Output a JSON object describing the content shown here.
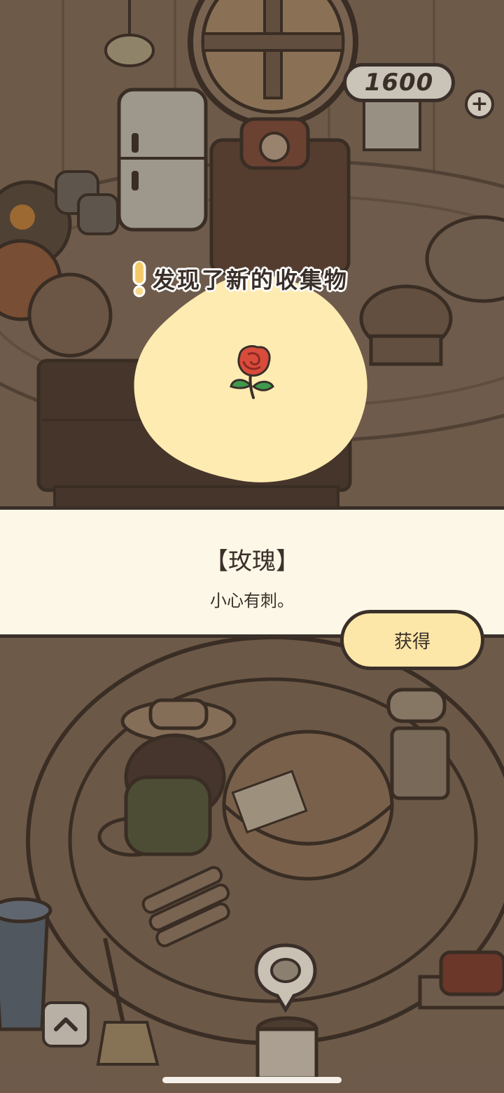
{
  "hud": {
    "coins": "1600",
    "add_icon": "plus-icon"
  },
  "popup": {
    "discovery_title": "发现了新的收集物",
    "item_icon": "rose-icon",
    "item_name": "【玫瑰】",
    "item_description": "小心有刺。",
    "obtain_label": "获得"
  },
  "nav": {
    "expand_icon": "chevron-up-icon",
    "location_icon": "map-pin-icon"
  },
  "colors": {
    "outline": "#3a2f29",
    "panel_bg": "#fdf7e7",
    "blob": "#fdebb1",
    "button_bg": "#fde7a8",
    "scene_bg": "#7b6654"
  }
}
